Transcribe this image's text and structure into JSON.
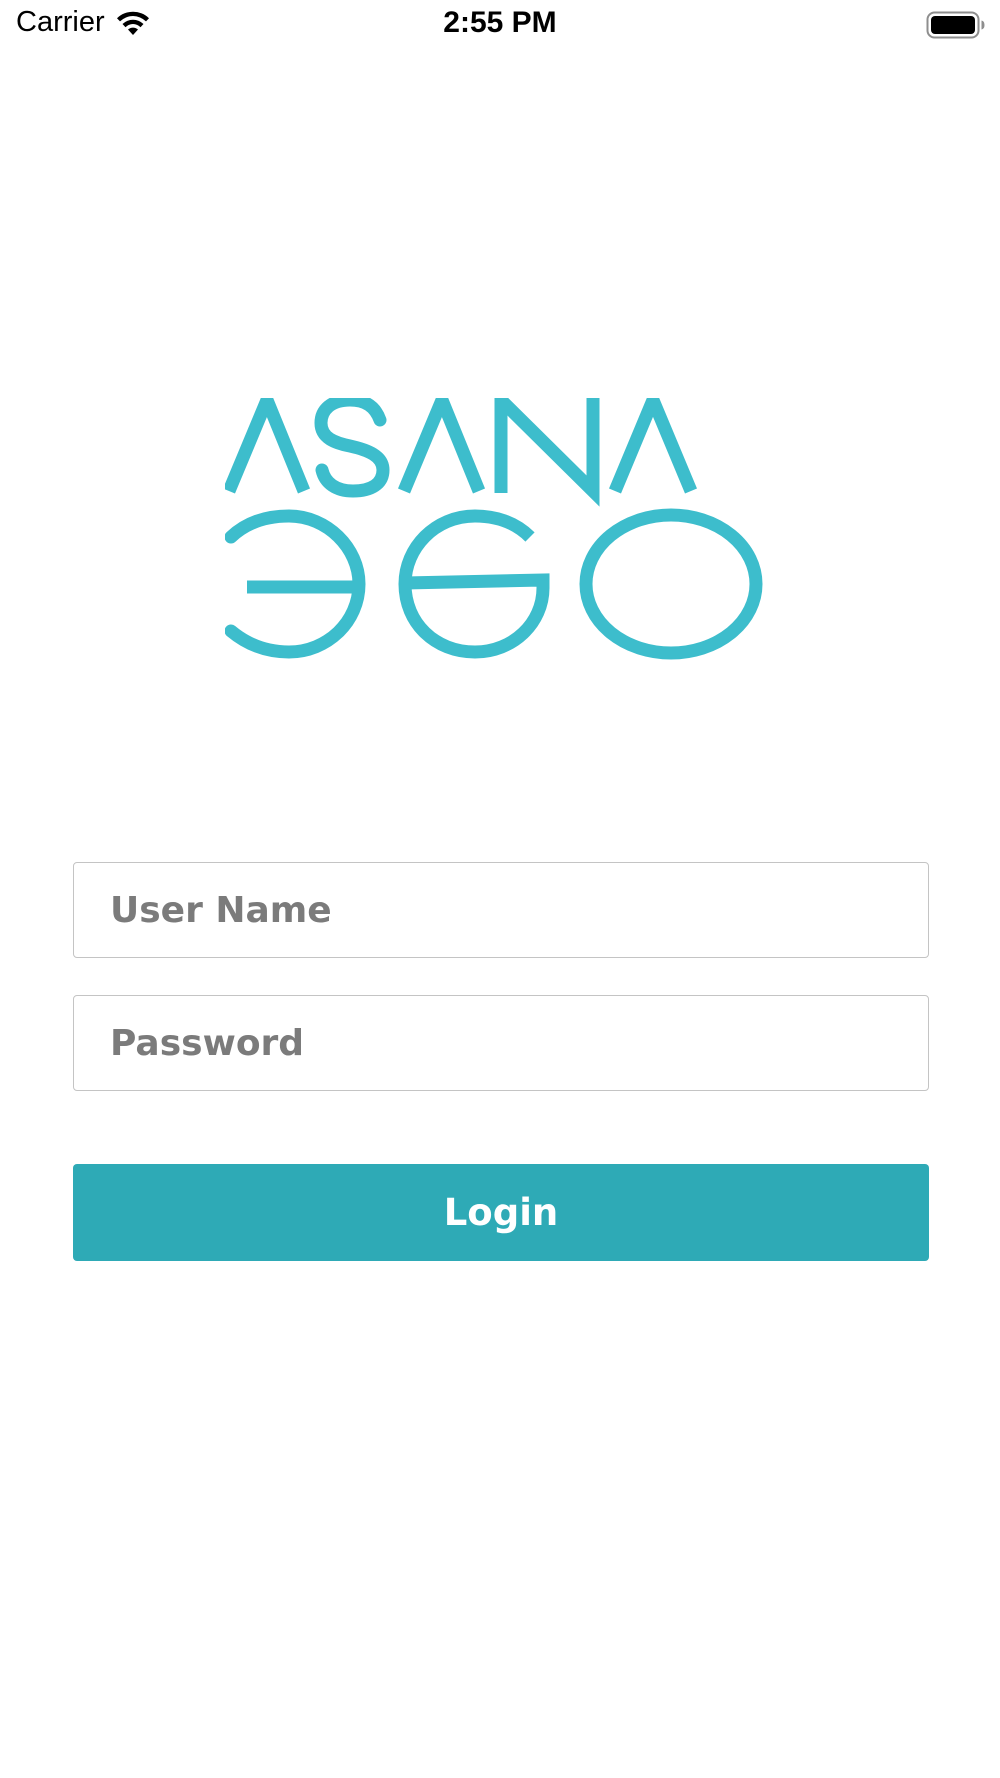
{
  "status_bar": {
    "carrier": "Carrier",
    "time": "2:55 PM",
    "wifi_icon": "wifi-icon",
    "battery_icon": "battery-full-icon"
  },
  "logo": {
    "text_top": "ASANA",
    "text_bottom": "360",
    "color": "#3DBDCC"
  },
  "form": {
    "username": {
      "placeholder": "User Name",
      "value": ""
    },
    "password": {
      "placeholder": "Password",
      "value": ""
    },
    "login_label": "Login",
    "login_color": "#2EAAB6"
  }
}
